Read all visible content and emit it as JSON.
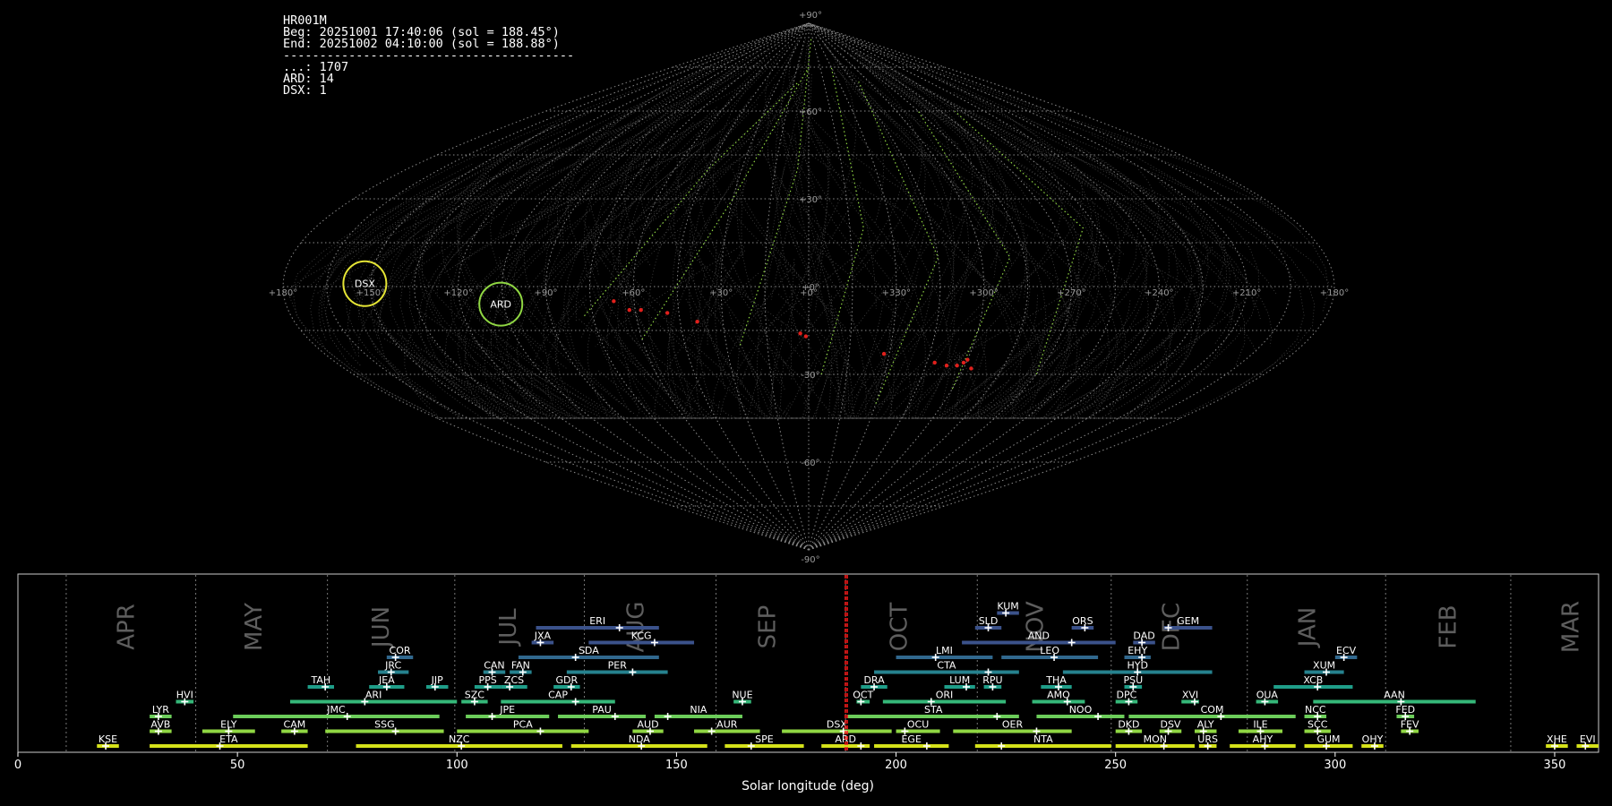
{
  "info": {
    "id": "HR001M",
    "beg": "Beg: 20251001 17:40:06 (sol = 188.45°)",
    "end": "End: 20251002 04:10:00 (sol = 188.88°)",
    "sep": "----------------------------------------",
    "counts": [
      "...: 1707",
      "ARD: 14",
      "DSX: 1"
    ]
  },
  "sky_map": {
    "projection": "sinusoidal",
    "lon_labels": [
      "+180°",
      "+150°",
      "+120°",
      "+90°",
      "+60°",
      "+30°",
      "+0°",
      "+330°",
      "+300°",
      "+270°",
      "+240°",
      "+210°",
      "+180°"
    ],
    "lat_labels": [
      "+90°",
      "+60°",
      "+30°",
      "+0°",
      "-30°",
      "-60°",
      "-90°"
    ],
    "radiants": [
      {
        "name": "DSX",
        "color": "#e5e535"
      },
      {
        "name": "ARD",
        "color": "#90d743"
      }
    ],
    "colors": {
      "grid": "#8a8a8a",
      "trail": "#7a7a7a",
      "shower_trail": "#90d743",
      "sporadic_point": "#e0201c"
    }
  },
  "chart_data": {
    "type": "timeline",
    "xlabel": "Solar longitude (deg)",
    "xlim": [
      0,
      360
    ],
    "x_ticks": [
      0,
      50,
      100,
      150,
      200,
      250,
      300,
      350
    ],
    "current_sol": [
      188.45,
      188.88
    ],
    "months": [
      {
        "name": "APR",
        "x": 25
      },
      {
        "name": "MAY",
        "x": 54
      },
      {
        "name": "JUN",
        "x": 83
      },
      {
        "name": "JUL",
        "x": 112
      },
      {
        "name": "AUG",
        "x": 141
      },
      {
        "name": "SEP",
        "x": 171
      },
      {
        "name": "OCT",
        "x": 201
      },
      {
        "name": "NOV",
        "x": 232
      },
      {
        "name": "DEC",
        "x": 263
      },
      {
        "name": "JAN",
        "x": 294
      },
      {
        "name": "FEB",
        "x": 326
      },
      {
        "name": "MAR",
        "x": 354
      }
    ],
    "month_boundaries": [
      11,
      40.5,
      70.5,
      99.5,
      129,
      159,
      188.5,
      218.5,
      249,
      280,
      311.5,
      340
    ],
    "showers": [
      {
        "code": "KUM",
        "start": 223,
        "end": 228,
        "peak": 225,
        "row": 9,
        "color": "#3b528b"
      },
      {
        "code": "ERI",
        "start": 118,
        "end": 146,
        "peak": 137,
        "row": 8,
        "color": "#3b528b"
      },
      {
        "code": "SLD",
        "start": 218,
        "end": 224,
        "peak": 221,
        "row": 8,
        "color": "#3b528b"
      },
      {
        "code": "ORS",
        "start": 240,
        "end": 245,
        "peak": 243,
        "row": 8,
        "color": "#3b528b"
      },
      {
        "code": "GEM",
        "start": 261,
        "end": 272,
        "peak": 262,
        "row": 8,
        "color": "#3b528b"
      },
      {
        "code": "JXA",
        "start": 117,
        "end": 122,
        "peak": 119,
        "row": 7,
        "color": "#3b528b"
      },
      {
        "code": "KCG",
        "start": 130,
        "end": 154,
        "peak": 145,
        "row": 7,
        "color": "#3b528b"
      },
      {
        "code": "AND",
        "start": 215,
        "end": 250,
        "peak": 240,
        "row": 7,
        "color": "#3b528b"
      },
      {
        "code": "DAD",
        "start": 254,
        "end": 259,
        "peak": 256,
        "row": 7,
        "color": "#3b528b"
      },
      {
        "code": "COR",
        "start": 84,
        "end": 90,
        "peak": 86,
        "row": 6,
        "color": "#31688e"
      },
      {
        "code": "SDA",
        "start": 114,
        "end": 146,
        "peak": 127,
        "row": 6,
        "color": "#31688e"
      },
      {
        "code": "LMI",
        "start": 200,
        "end": 222,
        "peak": 209,
        "row": 6,
        "color": "#31688e"
      },
      {
        "code": "LEO",
        "start": 224,
        "end": 246,
        "peak": 236,
        "row": 6,
        "color": "#31688e"
      },
      {
        "code": "EHY",
        "start": 252,
        "end": 258,
        "peak": 256,
        "row": 6,
        "color": "#31688e"
      },
      {
        "code": "ECV",
        "start": 300,
        "end": 305,
        "peak": 302,
        "row": 6,
        "color": "#31688e"
      },
      {
        "code": "JRC",
        "start": 82,
        "end": 89,
        "peak": 85,
        "row": 5,
        "color": "#26828e"
      },
      {
        "code": "CAN",
        "start": 106,
        "end": 111,
        "peak": 108,
        "row": 5,
        "color": "#26828e"
      },
      {
        "code": "FAN",
        "start": 112,
        "end": 117,
        "peak": 115,
        "row": 5,
        "color": "#26828e"
      },
      {
        "code": "PER",
        "start": 125,
        "end": 148,
        "peak": 140,
        "row": 5,
        "color": "#26828e"
      },
      {
        "code": "CTA",
        "start": 195,
        "end": 228,
        "peak": 221,
        "row": 5,
        "color": "#26828e"
      },
      {
        "code": "HYD",
        "start": 238,
        "end": 272,
        "peak": 255,
        "row": 5,
        "color": "#26828e"
      },
      {
        "code": "XUM",
        "start": 293,
        "end": 302,
        "peak": 298,
        "row": 5,
        "color": "#26828e"
      },
      {
        "code": "TAH",
        "start": 66,
        "end": 72,
        "peak": 70,
        "row": 4,
        "color": "#1f9e89"
      },
      {
        "code": "JEA",
        "start": 80,
        "end": 88,
        "peak": 84,
        "row": 4,
        "color": "#1f9e89"
      },
      {
        "code": "JIP",
        "start": 93,
        "end": 98,
        "peak": 95,
        "row": 4,
        "color": "#1f9e89"
      },
      {
        "code": "PPS",
        "start": 104,
        "end": 110,
        "peak": 107,
        "row": 4,
        "color": "#1f9e89"
      },
      {
        "code": "ZCS",
        "start": 110,
        "end": 116,
        "peak": 112,
        "row": 4,
        "color": "#1f9e89"
      },
      {
        "code": "GDR",
        "start": 122,
        "end": 128,
        "peak": 126,
        "row": 4,
        "color": "#1f9e89"
      },
      {
        "code": "DRA",
        "start": 192,
        "end": 198,
        "peak": 195,
        "row": 4,
        "color": "#1f9e89"
      },
      {
        "code": "LUM",
        "start": 211,
        "end": 218,
        "peak": 216,
        "row": 4,
        "color": "#1f9e89"
      },
      {
        "code": "RPU",
        "start": 220,
        "end": 224,
        "peak": 222,
        "row": 4,
        "color": "#1f9e89"
      },
      {
        "code": "THA",
        "start": 233,
        "end": 240,
        "peak": 237,
        "row": 4,
        "color": "#1f9e89"
      },
      {
        "code": "PSU",
        "start": 252,
        "end": 256,
        "peak": 254,
        "row": 4,
        "color": "#1f9e89"
      },
      {
        "code": "XCB",
        "start": 286,
        "end": 304,
        "peak": 296,
        "row": 4,
        "color": "#1f9e89"
      },
      {
        "code": "HVI",
        "start": 36,
        "end": 40,
        "peak": 38,
        "row": 3,
        "color": "#35b779"
      },
      {
        "code": "ARI",
        "start": 62,
        "end": 100,
        "peak": 79,
        "row": 3,
        "color": "#35b779"
      },
      {
        "code": "SZC",
        "start": 101,
        "end": 107,
        "peak": 104,
        "row": 3,
        "color": "#35b779"
      },
      {
        "code": "CAP",
        "start": 110,
        "end": 136,
        "peak": 127,
        "row": 3,
        "color": "#35b779"
      },
      {
        "code": "NUE",
        "start": 163,
        "end": 167,
        "peak": 165,
        "row": 3,
        "color": "#35b779"
      },
      {
        "code": "OCT",
        "start": 191,
        "end": 194,
        "peak": 192,
        "row": 3,
        "color": "#35b779"
      },
      {
        "code": "ORI",
        "start": 197,
        "end": 225,
        "peak": 208,
        "row": 3,
        "color": "#35b779"
      },
      {
        "code": "AMO",
        "start": 231,
        "end": 243,
        "peak": 239,
        "row": 3,
        "color": "#35b779"
      },
      {
        "code": "DPC",
        "start": 250,
        "end": 255,
        "peak": 253,
        "row": 3,
        "color": "#35b779"
      },
      {
        "code": "XVI",
        "start": 265,
        "end": 269,
        "peak": 268,
        "row": 3,
        "color": "#35b779"
      },
      {
        "code": "OUA",
        "start": 282,
        "end": 287,
        "peak": 284,
        "row": 3,
        "color": "#35b779"
      },
      {
        "code": "AAN",
        "start": 295,
        "end": 332,
        "peak": 315,
        "row": 3,
        "color": "#35b779"
      },
      {
        "code": "LYR",
        "start": 30,
        "end": 35,
        "peak": 32,
        "row": 2,
        "color": "#6ccd5a"
      },
      {
        "code": "JMC",
        "start": 49,
        "end": 96,
        "peak": 75,
        "row": 2,
        "color": "#6ccd5a"
      },
      {
        "code": "JPE",
        "start": 102,
        "end": 121,
        "peak": 108,
        "row": 2,
        "color": "#6ccd5a"
      },
      {
        "code": "PAU",
        "start": 123,
        "end": 143,
        "peak": 136,
        "row": 2,
        "color": "#6ccd5a"
      },
      {
        "code": "NIA",
        "start": 145,
        "end": 165,
        "peak": 148,
        "row": 2,
        "color": "#6ccd5a"
      },
      {
        "code": "STA",
        "start": 189,
        "end": 228,
        "peak": 223,
        "row": 2,
        "color": "#6ccd5a"
      },
      {
        "code": "NOO",
        "start": 232,
        "end": 252,
        "peak": 246,
        "row": 2,
        "color": "#6ccd5a"
      },
      {
        "code": "COM",
        "start": 253,
        "end": 291,
        "peak": 274,
        "row": 2,
        "color": "#6ccd5a"
      },
      {
        "code": "NCC",
        "start": 293,
        "end": 298,
        "peak": 296,
        "row": 2,
        "color": "#6ccd5a"
      },
      {
        "code": "FED",
        "start": 314,
        "end": 318,
        "peak": 316,
        "row": 2,
        "color": "#6ccd5a"
      },
      {
        "code": "AVB",
        "start": 30,
        "end": 35,
        "peak": 32,
        "row": 1,
        "color": "#90d743"
      },
      {
        "code": "ELY",
        "start": 42,
        "end": 54,
        "peak": 48,
        "row": 1,
        "color": "#90d743"
      },
      {
        "code": "CAM",
        "start": 60,
        "end": 66,
        "peak": 63,
        "row": 1,
        "color": "#90d743"
      },
      {
        "code": "SSG",
        "start": 70,
        "end": 97,
        "peak": 86,
        "row": 1,
        "color": "#90d743"
      },
      {
        "code": "PCA",
        "start": 100,
        "end": 130,
        "peak": 119,
        "row": 1,
        "color": "#90d743"
      },
      {
        "code": "AUD",
        "start": 140,
        "end": 147,
        "peak": 144,
        "row": 1,
        "color": "#90d743"
      },
      {
        "code": "AUR",
        "start": 154,
        "end": 169,
        "peak": 158,
        "row": 1,
        "color": "#90d743"
      },
      {
        "code": "DSX",
        "start": 174,
        "end": 199,
        "peak": 188,
        "row": 1,
        "color": "#90d743"
      },
      {
        "code": "OCU",
        "start": 200,
        "end": 210,
        "peak": 202,
        "row": 1,
        "color": "#90d743"
      },
      {
        "code": "OER",
        "start": 213,
        "end": 240,
        "peak": 232,
        "row": 1,
        "color": "#90d743"
      },
      {
        "code": "DKD",
        "start": 250,
        "end": 256,
        "peak": 253,
        "row": 1,
        "color": "#90d743"
      },
      {
        "code": "DSV",
        "start": 260,
        "end": 265,
        "peak": 262,
        "row": 1,
        "color": "#90d743"
      },
      {
        "code": "ALY",
        "start": 268,
        "end": 273,
        "peak": 270,
        "row": 1,
        "color": "#90d743"
      },
      {
        "code": "ILE",
        "start": 278,
        "end": 288,
        "peak": 283,
        "row": 1,
        "color": "#90d743"
      },
      {
        "code": "SCC",
        "start": 293,
        "end": 299,
        "peak": 296,
        "row": 1,
        "color": "#90d743"
      },
      {
        "code": "FEV",
        "start": 315,
        "end": 319,
        "peak": 317,
        "row": 1,
        "color": "#90d743"
      },
      {
        "code": "KSE",
        "start": 18,
        "end": 23,
        "peak": 20,
        "row": 0,
        "color": "#d5e21a"
      },
      {
        "code": "ETA",
        "start": 30,
        "end": 66,
        "peak": 46,
        "row": 0,
        "color": "#d5e21a"
      },
      {
        "code": "NZC",
        "start": 77,
        "end": 124,
        "peak": 101,
        "row": 0,
        "color": "#d5e21a"
      },
      {
        "code": "NDA",
        "start": 126,
        "end": 157,
        "peak": 142,
        "row": 0,
        "color": "#d5e21a"
      },
      {
        "code": "SPE",
        "start": 161,
        "end": 179,
        "peak": 167,
        "row": 0,
        "color": "#d5e21a"
      },
      {
        "code": "ARD",
        "start": 183,
        "end": 194,
        "peak": 192,
        "row": 0,
        "color": "#d5e21a"
      },
      {
        "code": "EGE",
        "start": 195,
        "end": 212,
        "peak": 207,
        "row": 0,
        "color": "#d5e21a"
      },
      {
        "code": "NTA",
        "start": 218,
        "end": 249,
        "peak": 224,
        "row": 0,
        "color": "#d5e21a"
      },
      {
        "code": "MON",
        "start": 250,
        "end": 268,
        "peak": 261,
        "row": 0,
        "color": "#d5e21a"
      },
      {
        "code": "URS",
        "start": 269,
        "end": 273,
        "peak": 271,
        "row": 0,
        "color": "#d5e21a"
      },
      {
        "code": "AHY",
        "start": 276,
        "end": 291,
        "peak": 284,
        "row": 0,
        "color": "#d5e21a"
      },
      {
        "code": "GUM",
        "start": 293,
        "end": 304,
        "peak": 298,
        "row": 0,
        "color": "#d5e21a"
      },
      {
        "code": "OHY",
        "start": 306,
        "end": 311,
        "peak": 309,
        "row": 0,
        "color": "#d5e21a"
      },
      {
        "code": "XHE",
        "start": 348,
        "end": 353,
        "peak": 350,
        "row": 0,
        "color": "#d5e21a"
      },
      {
        "code": "EVI",
        "start": 355,
        "end": 360,
        "peak": 357,
        "row": 0,
        "color": "#d5e21a"
      }
    ]
  }
}
